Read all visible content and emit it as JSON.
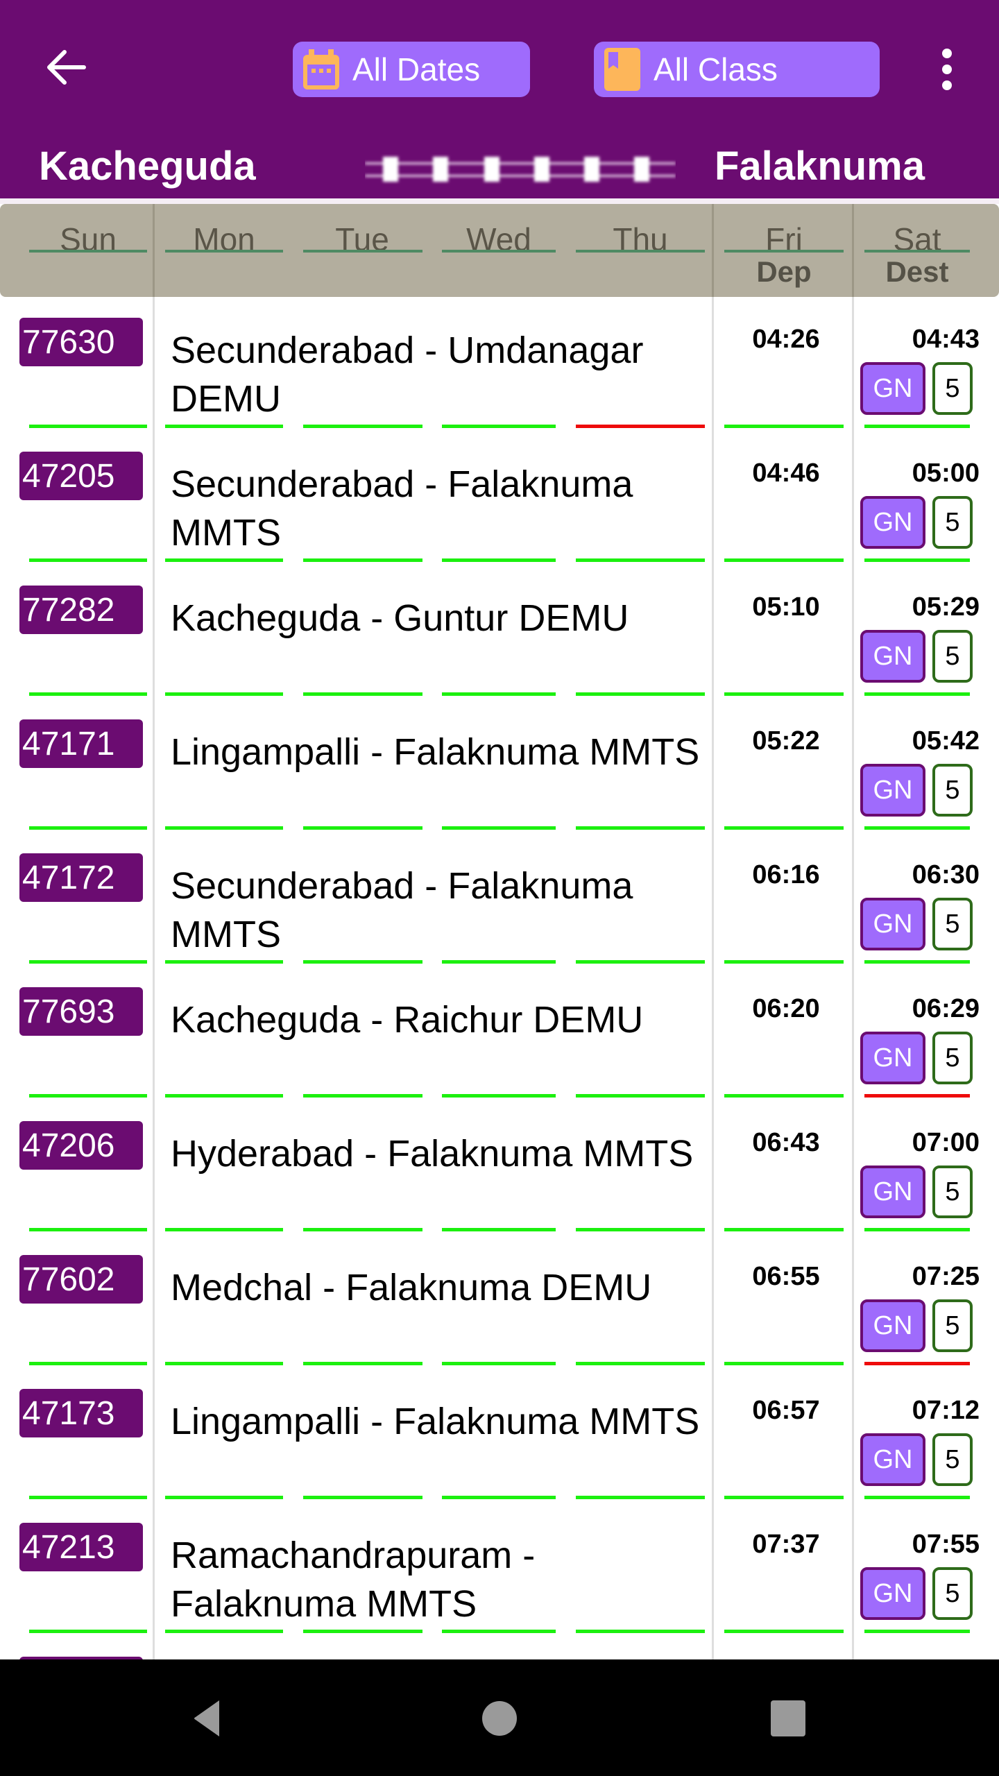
{
  "appbar": {
    "back_icon": "arrow-left-icon",
    "filters": [
      {
        "label": "All Dates",
        "icon": "calendar-icon"
      },
      {
        "label": "All Class",
        "icon": "bookmark-icon"
      }
    ],
    "menu_icon": "more-vert-icon",
    "from_station": "Kacheguda",
    "to_station": "Falaknuma",
    "route_icon": "railway-track-icon"
  },
  "header": {
    "days": [
      "Sun",
      "Mon",
      "Tue",
      "Wed",
      "Thu",
      "Fri",
      "Sat"
    ],
    "dep_label": "Dep",
    "dest_label": "Dest"
  },
  "colors": {
    "primary": "#6b0c71",
    "accent": "#9f6bfc",
    "runs": "#1cf00f",
    "not_runs": "#ee0b0b",
    "seat_border": "#2e6b1a",
    "header_bg": "#b3ae9e"
  },
  "trains": [
    {
      "number": "77630",
      "name": "Secunderabad - Umdanagar DEMU",
      "dep": "04:26",
      "arr": "04:43",
      "class": "GN",
      "avail": "5",
      "runs": [
        true,
        true,
        true,
        true,
        false,
        true,
        true
      ]
    },
    {
      "number": "47205",
      "name": "Secunderabad - Falaknuma MMTS",
      "dep": "04:46",
      "arr": "05:00",
      "class": "GN",
      "avail": "5",
      "runs": [
        true,
        true,
        true,
        true,
        true,
        true,
        true
      ]
    },
    {
      "number": "77282",
      "name": "Kacheguda - Guntur DEMU",
      "dep": "05:10",
      "arr": "05:29",
      "class": "GN",
      "avail": "5",
      "runs": [
        true,
        true,
        true,
        true,
        true,
        true,
        true
      ]
    },
    {
      "number": "47171",
      "name": "Lingampalli - Falaknuma MMTS",
      "dep": "05:22",
      "arr": "05:42",
      "class": "GN",
      "avail": "5",
      "runs": [
        true,
        true,
        true,
        true,
        true,
        true,
        true
      ]
    },
    {
      "number": "47172",
      "name": "Secunderabad - Falaknuma MMTS",
      "dep": "06:16",
      "arr": "06:30",
      "class": "GN",
      "avail": "5",
      "runs": [
        true,
        true,
        true,
        true,
        true,
        true,
        true
      ]
    },
    {
      "number": "77693",
      "name": "Kacheguda - Raichur DEMU",
      "dep": "06:20",
      "arr": "06:29",
      "class": "GN",
      "avail": "5",
      "runs": [
        true,
        true,
        true,
        true,
        true,
        true,
        false
      ]
    },
    {
      "number": "47206",
      "name": "Hyderabad - Falaknuma MMTS",
      "dep": "06:43",
      "arr": "07:00",
      "class": "GN",
      "avail": "5",
      "runs": [
        true,
        true,
        true,
        true,
        true,
        true,
        true
      ]
    },
    {
      "number": "77602",
      "name": "Medchal - Falaknuma DEMU",
      "dep": "06:55",
      "arr": "07:25",
      "class": "GN",
      "avail": "5",
      "runs": [
        true,
        true,
        true,
        true,
        true,
        true,
        false
      ]
    },
    {
      "number": "47173",
      "name": "Lingampalli - Falaknuma MMTS",
      "dep": "06:57",
      "arr": "07:12",
      "class": "GN",
      "avail": "5",
      "runs": [
        true,
        true,
        true,
        true,
        true,
        true,
        true
      ]
    },
    {
      "number": "47213",
      "name": "Ramachandrapuram - Falaknuma MMTS",
      "dep": "07:37",
      "arr": "07:55",
      "class": "GN",
      "avail": "5",
      "runs": [
        true,
        true,
        true,
        true,
        true,
        true,
        true
      ]
    },
    {
      "number": "",
      "name": "",
      "dep": "",
      "arr": "",
      "class": "",
      "avail": "",
      "runs": []
    }
  ],
  "navbar": {
    "back_icon": "nav-back-icon",
    "home_icon": "nav-home-icon",
    "recents_icon": "nav-recents-icon"
  }
}
